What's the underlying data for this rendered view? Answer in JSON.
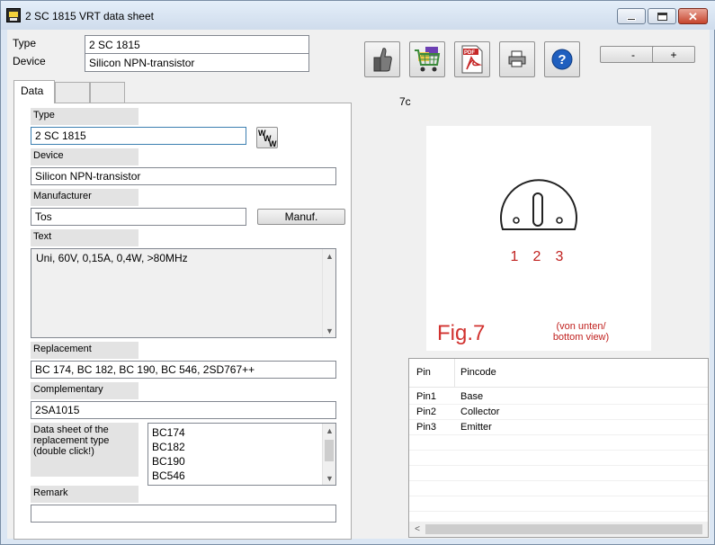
{
  "window": {
    "title": "2 SC 1815 VRT data sheet",
    "close_glyph": "✕"
  },
  "header": {
    "type_label": "Type",
    "device_label": "Device",
    "type_value": "2 SC 1815",
    "device_value": "Silicon NPN-transistor"
  },
  "toolbar": {
    "minus_label": "-",
    "plus_label": "+",
    "help_glyph": "?"
  },
  "tabs": [
    {
      "label": "Data"
    },
    {
      "label": ""
    },
    {
      "label": ""
    }
  ],
  "form": {
    "type_label": "Type",
    "type_value": "2 SC 1815",
    "www_glyph": "W",
    "device_label": "Device",
    "device_value": "Silicon NPN-transistor",
    "manufacturer_label": "Manufacturer",
    "manufacturer_value": "Tos",
    "manuf_button": "Manuf.",
    "text_label": "Text",
    "text_value": "Uni, 60V, 0,15A, 0,4W, >80MHz",
    "replacement_label": "Replacement",
    "replacement_value": "BC 174, BC 182, BC 190, BC 546, 2SD767++",
    "complementary_label": "Complementary",
    "complementary_value": "2SA1015",
    "datasheet_label": "Data sheet of the replacement type (double click!)",
    "datasheet_items": [
      "BC174",
      "BC182",
      "BC190",
      "BC546"
    ],
    "remark_label": "Remark",
    "remark_value": ""
  },
  "figure": {
    "code": "7c",
    "pins": [
      "1",
      "2",
      "3"
    ],
    "caption": "Fig.7",
    "view_note_line1": "(von unten/",
    "view_note_line2": "bottom view)"
  },
  "pin_table": {
    "headers": [
      "Pin",
      "Pincode"
    ],
    "rows": [
      {
        "pin": "Pin1",
        "code": "Base"
      },
      {
        "pin": "Pin2",
        "code": "Collector"
      },
      {
        "pin": "Pin3",
        "code": "Emitter"
      }
    ]
  },
  "colors": {
    "pin_number_red": "#c0211f",
    "fig_caption_red": "#d1322f",
    "help_blue": "#1f5fbf"
  }
}
